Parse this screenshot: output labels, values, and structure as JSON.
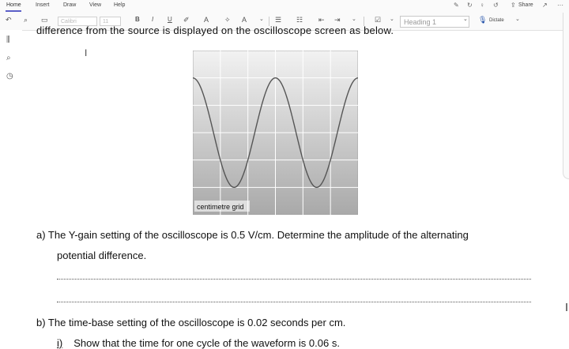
{
  "ribbon": {
    "tabs": [
      "Home",
      "Insert",
      "Draw",
      "View",
      "Help"
    ],
    "share_label": "Share",
    "more_label": "···"
  },
  "toolbar": {
    "font_name": "Calibri",
    "font_size": "11",
    "bold": "B",
    "italic": "I",
    "underline": "U",
    "style_value": "Heading 1",
    "dictate_label": "Dictate"
  },
  "document": {
    "cut_line": "difference from the source is displayed on the oscilloscope screen as below.",
    "grid_caption": "centimetre grid",
    "question_a_line1": "a)   The Y-gain setting of the oscilloscope is 0.5 V/cm. Determine the amplitude of the alternating",
    "question_a_line2": "potential difference.",
    "question_b": "b)   The time-base setting of the oscilloscope is 0.02 seconds per cm.",
    "question_b_i_num": "i)",
    "question_b_i_text": "Show that the time for one cycle of the waveform is 0.06 s."
  },
  "oscilloscope": {
    "grid_columns": 6,
    "grid_rows": 6,
    "wave": {
      "amplitude_cm": 2,
      "period_cm": 3,
      "cycles_shown": 2
    },
    "colors": {
      "background_top": "#f2f2f2",
      "background_bottom": "#a9a9a9",
      "grid": "#ffffff",
      "trace": "#555555"
    }
  },
  "colors": {
    "accent": "#5b5fc7",
    "dictate_blue": "#1f4fa8"
  }
}
